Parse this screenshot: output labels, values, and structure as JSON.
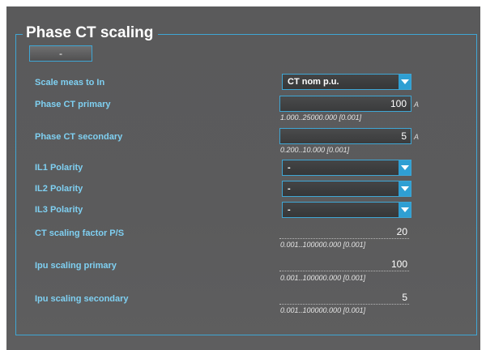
{
  "section": {
    "title": "Phase CT scaling",
    "minus_button_label": "-"
  },
  "fields": {
    "scale_meas": {
      "label": "Scale meas to In",
      "value": "CT nom p.u."
    },
    "ct_primary": {
      "label": "Phase CT primary",
      "value": "100",
      "unit": "A",
      "range": "1.000..25000.000 [0.001]"
    },
    "ct_secondary": {
      "label": "Phase CT secondary",
      "value": "5",
      "unit": "A",
      "range": "0.200..10.000 [0.001]"
    },
    "il1_polarity": {
      "label": "IL1 Polarity",
      "value": "-"
    },
    "il2_polarity": {
      "label": "IL2 Polarity",
      "value": "-"
    },
    "il3_polarity": {
      "label": "IL3 Polarity",
      "value": "-"
    },
    "ct_factor": {
      "label": "CT scaling factor P/S",
      "value": "20",
      "range": "0.001..100000.000 [0.001]"
    },
    "ipu_primary": {
      "label": "Ipu scaling primary",
      "value": "100",
      "range": "0.001..100000.000 [0.001]"
    },
    "ipu_secondary": {
      "label": "Ipu scaling secondary",
      "value": "5",
      "range": "0.001..100000.000 [0.001]"
    }
  },
  "colors": {
    "accent": "#3fa6d4",
    "label": "#7fd0f2",
    "panel_bg": "#5a5a5b"
  }
}
